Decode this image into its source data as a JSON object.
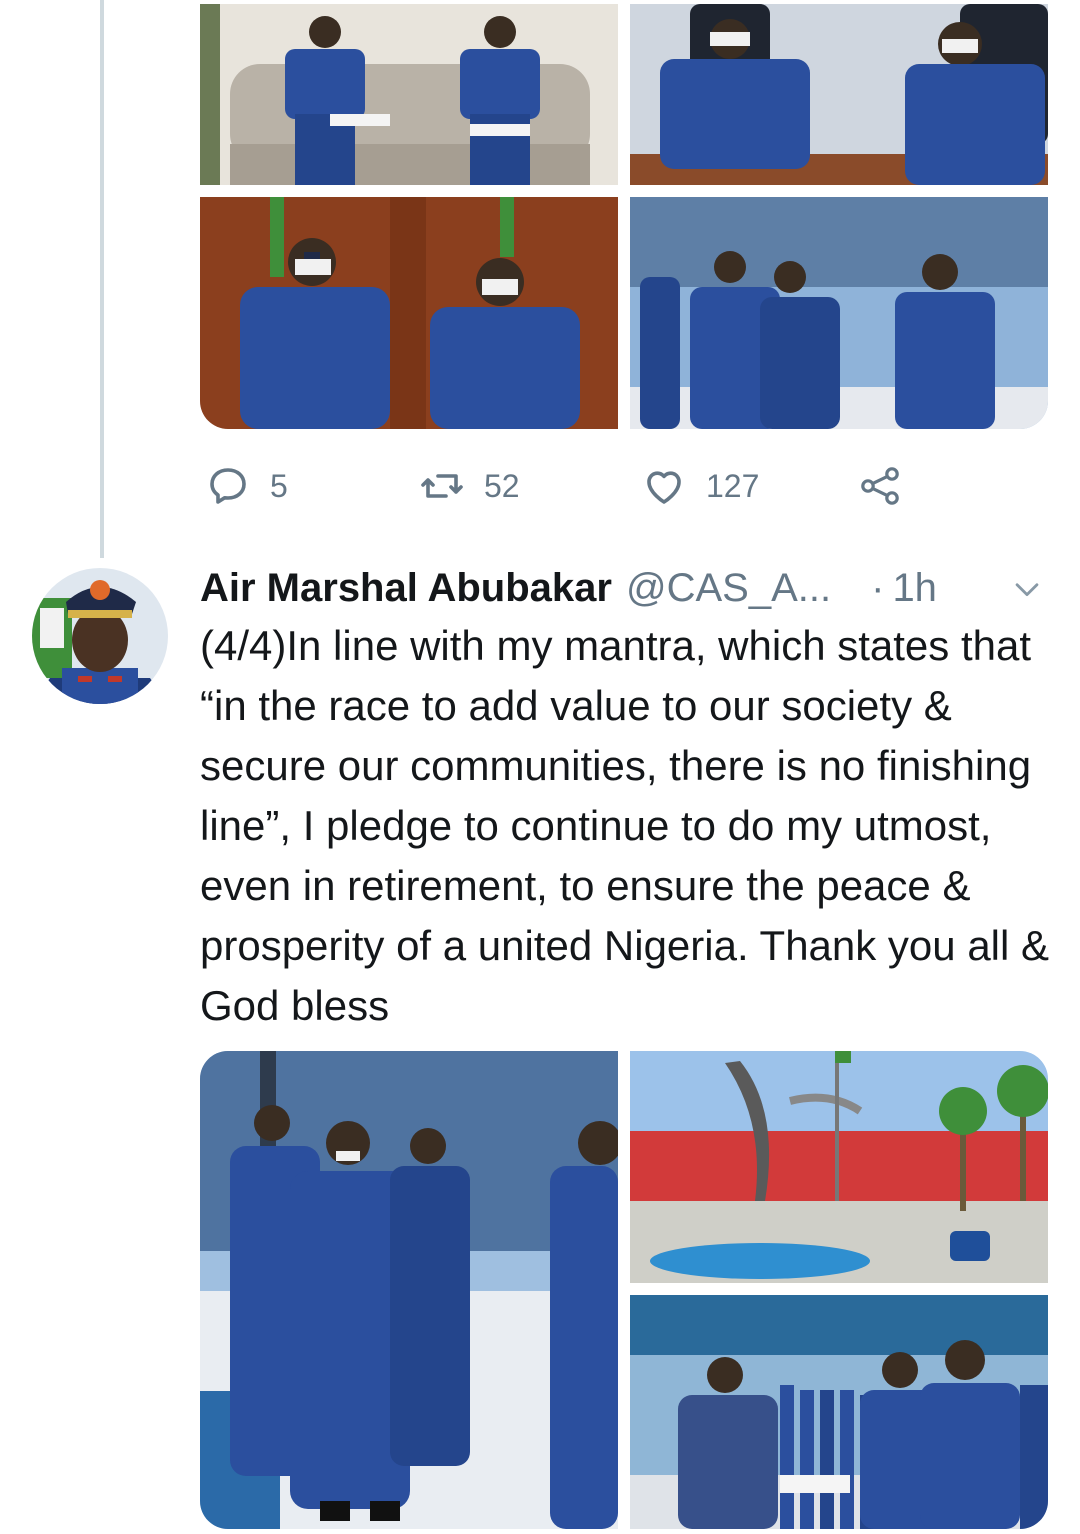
{
  "previous_tweet": {
    "media_count": 4,
    "actions": {
      "replies": "5",
      "retweets": "52",
      "likes": "127"
    }
  },
  "tweet": {
    "author_name": "Air Marshal Abubakar",
    "handle": "@CAS_A...",
    "separator": "·",
    "time": "1h",
    "text": "(4/4)In line with my mantra, which states that “in the race to add value to our society & secure our communities, there is no finishing line”, I pledge to continue to do my utmost, even in retirement, to ensure the peace & prosperity of a united Nigeria. Thank you all & God bless",
    "media_count": 3
  },
  "icons": {
    "reply": "reply-icon",
    "retweet": "retweet-icon",
    "like": "heart-icon",
    "share": "share-icon",
    "more": "chevron-down-icon"
  },
  "colors": {
    "text": "#14171a",
    "secondary": "#657786",
    "thread_line": "#cfd9de",
    "uniform_blue": "#2b4f9e"
  }
}
